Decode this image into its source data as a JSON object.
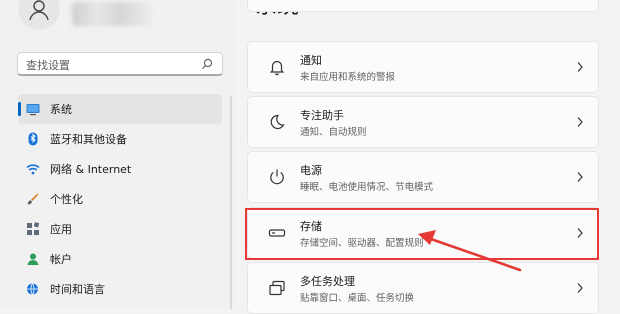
{
  "page_title": "系统",
  "search": {
    "placeholder": "查找设置"
  },
  "nav": [
    {
      "label": "系统",
      "icon": "monitor-icon"
    },
    {
      "label": "蓝牙和其他设备",
      "icon": "bluetooth-icon"
    },
    {
      "label": "网络 & Internet",
      "icon": "wifi-icon"
    },
    {
      "label": "个性化",
      "icon": "brush-icon"
    },
    {
      "label": "应用",
      "icon": "apps-icon"
    },
    {
      "label": "帐户",
      "icon": "account-icon"
    },
    {
      "label": "时间和语言",
      "icon": "globe-clock-icon"
    }
  ],
  "cards": [
    {
      "title": "通知",
      "subtitle": "来自应用和系统的警报",
      "icon": "bell-icon"
    },
    {
      "title": "专注助手",
      "subtitle": "通知、自动规则",
      "icon": "moon-icon"
    },
    {
      "title": "电源",
      "subtitle": "睡眠、电池使用情况、节电模式",
      "icon": "power-icon"
    },
    {
      "title": "存储",
      "subtitle": "存储空间、驱动器、配置规则",
      "icon": "storage-icon"
    },
    {
      "title": "多任务处理",
      "subtitle": "贴靠窗口、桌面、任务切换",
      "icon": "multitask-icon"
    }
  ],
  "colors": {
    "accent": "#0067c0",
    "highlight": "#e53935"
  }
}
